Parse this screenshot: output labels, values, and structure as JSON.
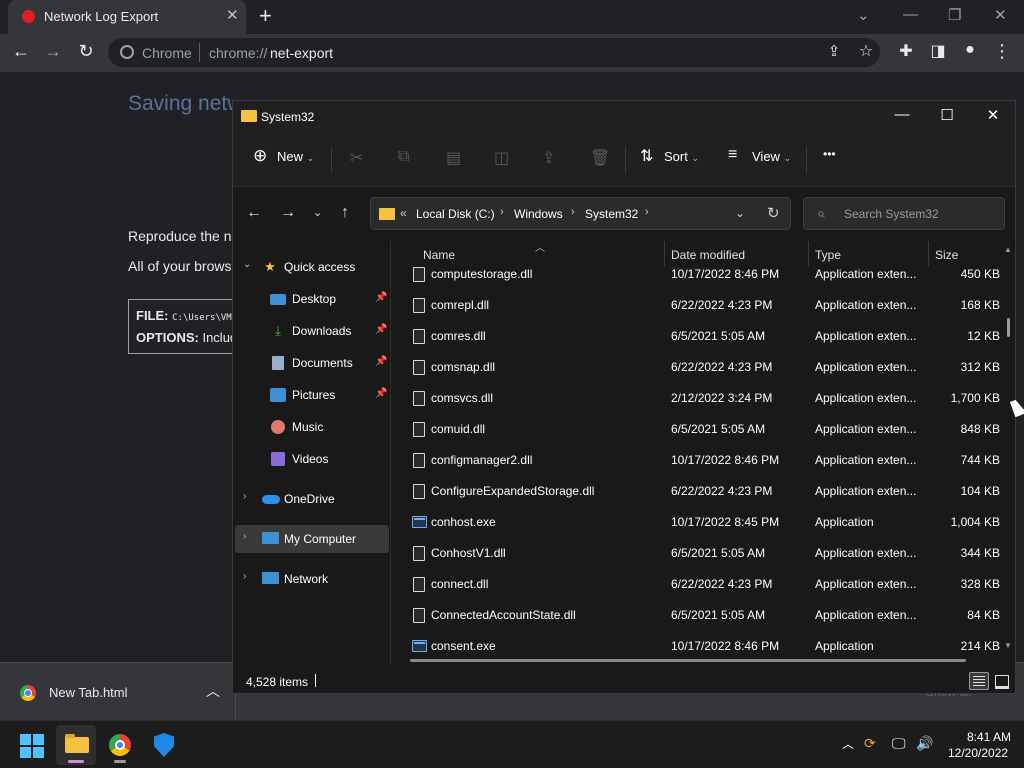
{
  "chrome": {
    "tab_title": "Network Log Export",
    "omnibox_site": "Chrome",
    "omnibox_scheme": "chrome://",
    "omnibox_path": "net-export"
  },
  "page": {
    "heading": "Saving network log to disk",
    "text_1": "Reproduce the net",
    "text_2": "All of your browse",
    "file_label": "FILE:",
    "file_value": "C:\\Users\\VM",
    "options_label": "OPTIONS:",
    "options_value": "Includ"
  },
  "download_bar": {
    "file_name": "New Tab.html",
    "show_all": "Show all"
  },
  "explorer": {
    "title": "System32",
    "toolbar": {
      "new_label": "New",
      "sort_label": "Sort",
      "view_label": "View",
      "more_label": "•••"
    },
    "address": {
      "overflow": "«",
      "crumbs": [
        "Local Disk (C:)",
        "Windows",
        "System32"
      ]
    },
    "search_placeholder": "Search System32",
    "nav": {
      "quick_access": "Quick access",
      "desktop": "Desktop",
      "downloads": "Downloads",
      "documents": "Documents",
      "pictures": "Pictures",
      "music": "Music",
      "videos": "Videos",
      "onedrive": "OneDrive",
      "my_computer": "My Computer",
      "network": "Network"
    },
    "columns": {
      "name": "Name",
      "date": "Date modified",
      "type": "Type",
      "size": "Size"
    },
    "rows": [
      {
        "name": "computestorage.dll",
        "date": "10/17/2022 8:46 PM",
        "type": "Application exten...",
        "size": "450 KB",
        "kind": "dll"
      },
      {
        "name": "comrepl.dll",
        "date": "6/22/2022 4:23 PM",
        "type": "Application exten...",
        "size": "168 KB",
        "kind": "dll"
      },
      {
        "name": "comres.dll",
        "date": "6/5/2021 5:05 AM",
        "type": "Application exten...",
        "size": "12 KB",
        "kind": "dll"
      },
      {
        "name": "comsnap.dll",
        "date": "6/22/2022 4:23 PM",
        "type": "Application exten...",
        "size": "312 KB",
        "kind": "dll"
      },
      {
        "name": "comsvcs.dll",
        "date": "2/12/2022 3:24 PM",
        "type": "Application exten...",
        "size": "1,700 KB",
        "kind": "dll"
      },
      {
        "name": "comuid.dll",
        "date": "6/5/2021 5:05 AM",
        "type": "Application exten...",
        "size": "848 KB",
        "kind": "dll"
      },
      {
        "name": "configmanager2.dll",
        "date": "10/17/2022 8:46 PM",
        "type": "Application exten...",
        "size": "744 KB",
        "kind": "dll"
      },
      {
        "name": "ConfigureExpandedStorage.dll",
        "date": "6/22/2022 4:23 PM",
        "type": "Application exten...",
        "size": "104 KB",
        "kind": "dll"
      },
      {
        "name": "conhost.exe",
        "date": "10/17/2022 8:45 PM",
        "type": "Application",
        "size": "1,004 KB",
        "kind": "exe"
      },
      {
        "name": "ConhostV1.dll",
        "date": "6/5/2021 5:05 AM",
        "type": "Application exten...",
        "size": "344 KB",
        "kind": "dll"
      },
      {
        "name": "connect.dll",
        "date": "6/22/2022 4:23 PM",
        "type": "Application exten...",
        "size": "328 KB",
        "kind": "dll"
      },
      {
        "name": "ConnectedAccountState.dll",
        "date": "6/5/2021 5:05 AM",
        "type": "Application exten...",
        "size": "84 KB",
        "kind": "dll"
      },
      {
        "name": "consent.exe",
        "date": "10/17/2022 8:46 PM",
        "type": "Application",
        "size": "214 KB",
        "kind": "exe"
      }
    ],
    "status_count": "4,528 items"
  },
  "taskbar": {
    "time": "8:41 AM",
    "date": "12/20/2022"
  },
  "colors": {
    "accent_blue": "#4cc2ff",
    "folder_yellow": "#f5c242",
    "chrome_red": "#e02020"
  }
}
